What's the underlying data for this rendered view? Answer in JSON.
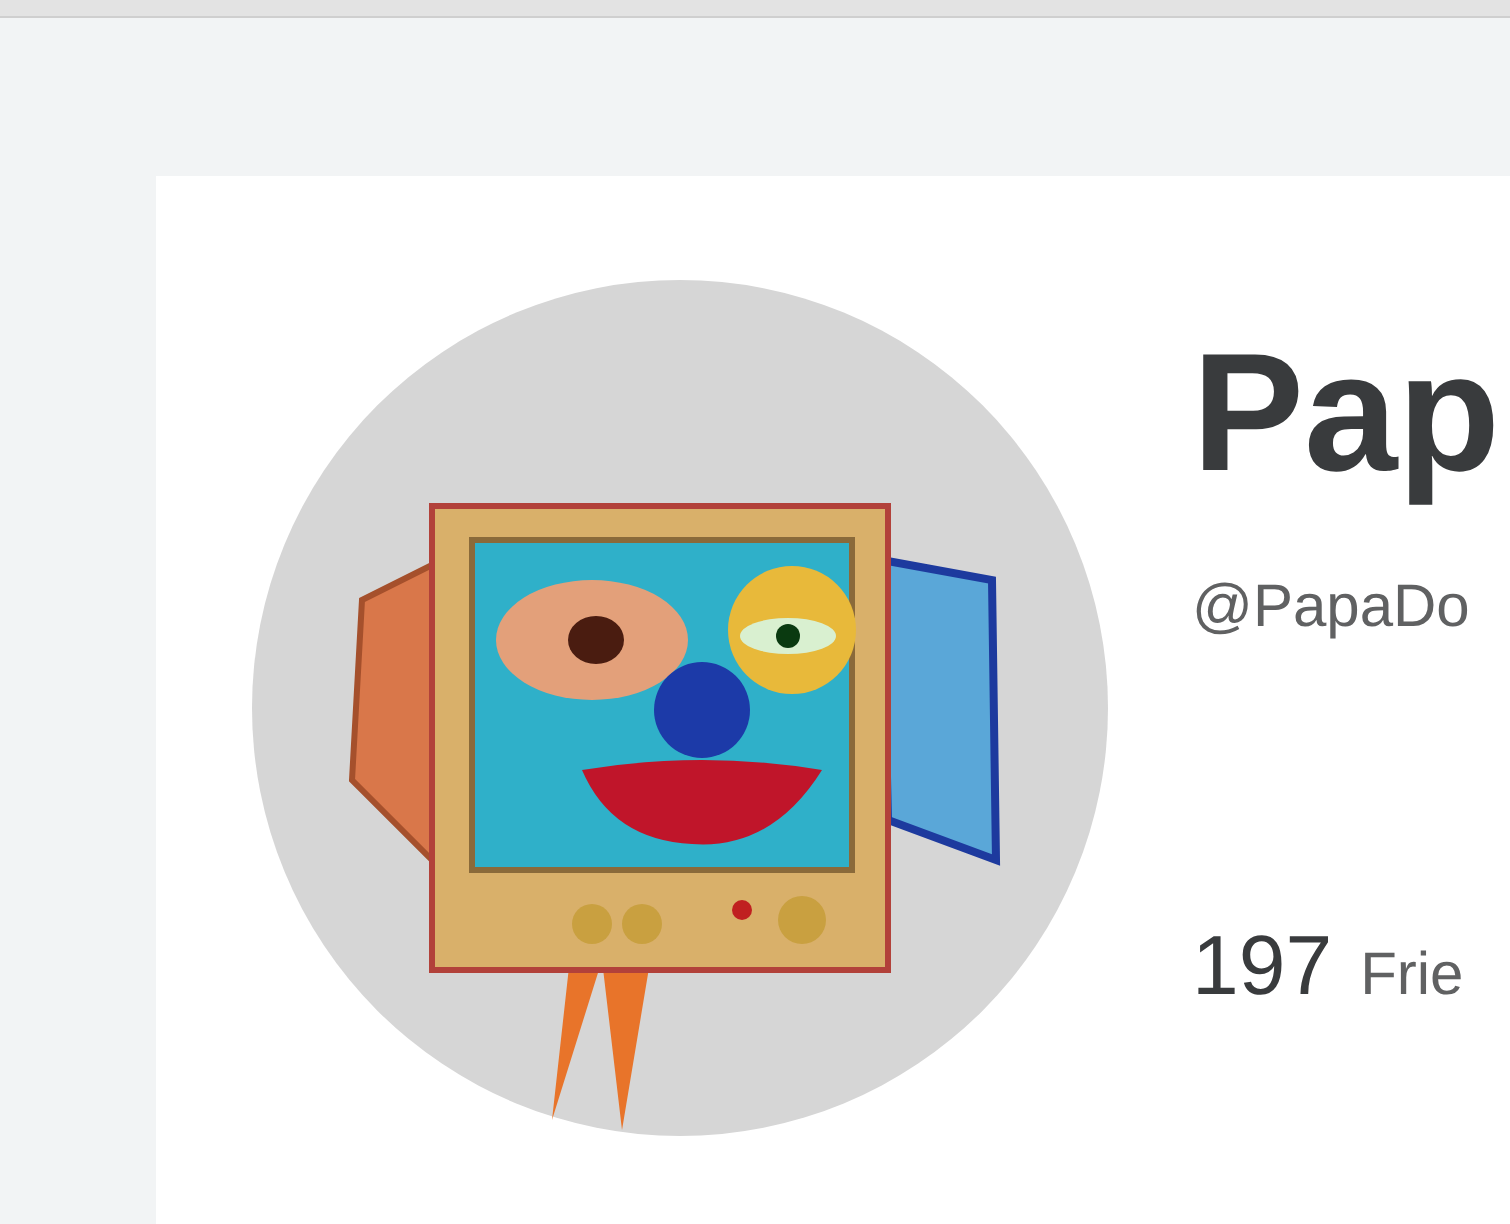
{
  "profile": {
    "display_name": "Pap",
    "username": "@PapaDo",
    "friends_count": "197",
    "friends_label": "Frie"
  }
}
